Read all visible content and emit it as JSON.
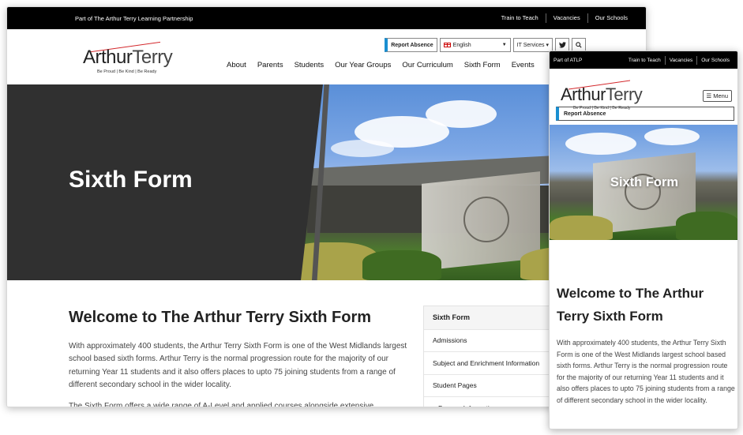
{
  "desktop": {
    "topbar": {
      "partner": "Part of The Arthur Terry Learning Partnership",
      "links": [
        "Train to Teach",
        "Vacancies",
        "Our Schools"
      ]
    },
    "logo": {
      "word1": "Arthur",
      "word2": "Terry",
      "tagline": "Be Proud | Be Kind | Be Ready"
    },
    "utility": {
      "report_absence": "Report Absence",
      "language": "English",
      "it_services": "IT Services ▾",
      "twitter_icon": "twitter-icon",
      "search_icon": "search-icon"
    },
    "nav": [
      "About",
      "Parents",
      "Students",
      "Our Year Groups",
      "Our Curriculum",
      "Sixth Form",
      "Events"
    ],
    "hero_title": "Sixth Form",
    "heading": "Welcome to The Arthur Terry Sixth Form",
    "paragraph": "With approximately 400 students, the Arthur Terry Sixth Form is one of the West Midlands largest school based sixth forms. Arthur Terry is the normal progression route for the majority of our returning Year 11 students and it also offers places to upto 75 joining students from a range of different secondary school in the wider locality.",
    "paragraph2": "The Sixth Form offers a wide range of A-Level and applied courses alongside extensive enrichment",
    "sidebar": [
      "Sixth Form",
      "Admissions",
      "Subject and Enrichment Information",
      "Student Pages",
      "Bursary Information"
    ]
  },
  "mobile": {
    "topbar": {
      "partner": "Part of ATLP",
      "links": [
        "Train to Teach",
        "Vacancies",
        "Our Schools"
      ]
    },
    "logo": {
      "word1": "Arthur",
      "word2": "Terry",
      "tagline": "Be Proud | Be Kind | Be Ready"
    },
    "menu_label": "Menu",
    "report_absence": "Report Absence",
    "hero_title": "Sixth Form",
    "heading": "Welcome to The Arthur Terry Sixth Form",
    "paragraph": "With approximately 400 students, the Arthur Terry Sixth Form is one of the West Midlands largest school based sixth forms. Arthur Terry is the normal progression route for the majority of our returning Year 11 students and it also offers places to upto 75 joining students from a range of different secondary school in the wider locality."
  },
  "colors": {
    "accent_blue": "#1a8fd1",
    "brand_red": "#d3262a",
    "topbar": "#000000",
    "hero_panel": "#303030"
  }
}
